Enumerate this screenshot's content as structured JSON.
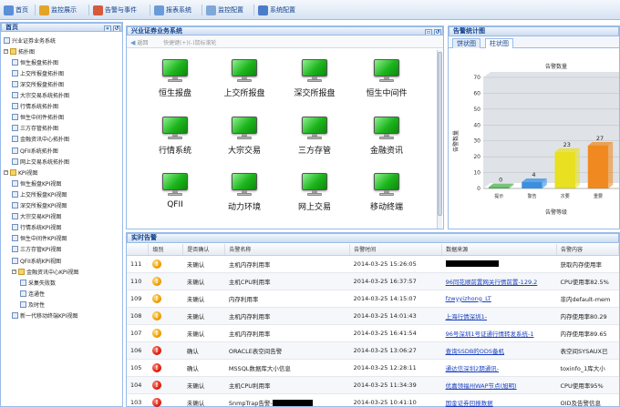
{
  "toolbar": {
    "items": [
      {
        "label": "首页",
        "icon": "home-icon"
      },
      {
        "label": "监控展示",
        "icon": "monitor-icon"
      },
      {
        "label": "告警与事件",
        "icon": "alarm-icon"
      },
      {
        "label": "报表系统",
        "icon": "report-icon"
      },
      {
        "label": "监控配置",
        "icon": "config-icon"
      },
      {
        "label": "系统配置",
        "icon": "system-icon"
      }
    ]
  },
  "sidebar": {
    "title": "首页",
    "header_buttons": [
      "«",
      "↺"
    ],
    "tree": [
      {
        "label": "兴业证券业务系统",
        "type": "leaf",
        "level": 0
      },
      {
        "label": "拓扑图",
        "type": "folder",
        "level": 0,
        "expanded": true
      },
      {
        "label": "恒生报盘拓扑图",
        "type": "leaf",
        "level": 1
      },
      {
        "label": "上交所报盘拓扑图",
        "type": "leaf",
        "level": 1
      },
      {
        "label": "深交所报盘拓扑图",
        "type": "leaf",
        "level": 1
      },
      {
        "label": "大宗交易系统拓扑图",
        "type": "leaf",
        "level": 1
      },
      {
        "label": "行情系统拓扑图",
        "type": "leaf",
        "level": 1
      },
      {
        "label": "恒生中间件拓扑图",
        "type": "leaf",
        "level": 1
      },
      {
        "label": "三方存管拓扑图",
        "type": "leaf",
        "level": 1
      },
      {
        "label": "金融资讯中心拓扑图",
        "type": "leaf",
        "level": 1
      },
      {
        "label": "QFII系统拓扑图",
        "type": "leaf",
        "level": 1
      },
      {
        "label": "网上交易系统拓扑图",
        "type": "leaf",
        "level": 1
      },
      {
        "label": "KPI视图",
        "type": "folder",
        "level": 0,
        "expanded": true
      },
      {
        "label": "恒生报盘KPI视图",
        "type": "leaf",
        "level": 1
      },
      {
        "label": "上交所报盘KPI视图",
        "type": "leaf",
        "level": 1
      },
      {
        "label": "深交所报盘KPI视图",
        "type": "leaf",
        "level": 1
      },
      {
        "label": "大宗交易KPI视图",
        "type": "leaf",
        "level": 1
      },
      {
        "label": "行情系统KPI视图",
        "type": "leaf",
        "level": 1
      },
      {
        "label": "恒生中间件KPI视图",
        "type": "leaf",
        "level": 1
      },
      {
        "label": "三方存管KPI视图",
        "type": "leaf",
        "level": 1
      },
      {
        "label": "QFII系统KPI视图",
        "type": "leaf",
        "level": 1
      },
      {
        "label": "金融资讯中心KPI视图",
        "type": "folder",
        "level": 1,
        "expanded": true
      },
      {
        "label": "采集失败数",
        "type": "leaf",
        "level": 2
      },
      {
        "label": "连通性",
        "type": "leaf",
        "level": 2
      },
      {
        "label": "及时性",
        "type": "leaf",
        "level": 2
      },
      {
        "label": "新一代移动终端KPI视图",
        "type": "leaf",
        "level": 1
      }
    ]
  },
  "business": {
    "title": "兴业证券业务系统",
    "back_label": "返回",
    "shortcut_hint": "快捷键(+)(-)鼠标滚轮",
    "systems": [
      "恒生报盘",
      "上交所报盘",
      "深交所报盘",
      "恒生中间件",
      "行情系统",
      "大宗交易",
      "三方存管",
      "金融资讯",
      "QFII",
      "动力环境",
      "网上交易",
      "移动终端"
    ]
  },
  "stats": {
    "title": "告警统计图",
    "tabs": [
      "饼状图",
      "柱状图"
    ],
    "active_tab": 1
  },
  "chart_data": {
    "type": "bar",
    "title": "告警数量",
    "xlabel": "告警等级",
    "ylabel": "告警数量",
    "categories": [
      "提示",
      "警告",
      "次要",
      "重要"
    ],
    "values": [
      0,
      4,
      23,
      27
    ],
    "colors": [
      "#4caf50",
      "#3a8fe0",
      "#e8e020",
      "#f08a20"
    ],
    "ylim": [
      0,
      70
    ],
    "yticks": [
      0,
      10,
      20,
      30,
      40,
      50,
      60,
      70
    ],
    "grid": true
  },
  "alarms": {
    "title": "实时告警",
    "columns": [
      "",
      "级别",
      "是否确认",
      "告警名称",
      "告警时间",
      "数据来源",
      "告警内容"
    ],
    "rows": [
      {
        "id": "111",
        "level": "orange",
        "ack": "未确认",
        "name": "主机内存利用率",
        "time": "2014-03-25 15:26:05",
        "source": "",
        "source_link": false,
        "content": "获取内存使用率",
        "redact_name": false
      },
      {
        "id": "110",
        "level": "orange",
        "ack": "未确认",
        "name": "主机CPU利用率",
        "time": "2014-03-25 16:37:57",
        "source": "96同花顺前置网关行情前置-129.2",
        "source_link": true,
        "content": "CPU使用率82.5%",
        "redact_name": false
      },
      {
        "id": "109",
        "level": "orange",
        "ack": "未确认",
        "name": "内存利用率",
        "time": "2014-03-25 14:15:07",
        "source": "fzwyyizhong_LT",
        "source_link": true,
        "content": "非内default-mem",
        "redact_name": false
      },
      {
        "id": "108",
        "level": "orange",
        "ack": "未确认",
        "name": "主机内存利用率",
        "time": "2014-03-25 14:01:43",
        "source": "上海行情深圳1-",
        "source_link": true,
        "content": "内存使用率80.29",
        "redact_name": false
      },
      {
        "id": "107",
        "level": "orange",
        "ack": "未确认",
        "name": "主机内存利用率",
        "time": "2014-03-25 16:41:54",
        "source": "96号深圳1号证通行情转发系统-1",
        "source_link": true,
        "content": "内存使用率89.65",
        "redact_name": false
      },
      {
        "id": "106",
        "level": "red",
        "ack": "确认",
        "name": "ORACLE表空间告警",
        "time": "2014-03-25 13:06:27",
        "source": "查询SSDB的ODS备机",
        "source_link": true,
        "content": "表空间SYSAUX已",
        "redact_name": false
      },
      {
        "id": "105",
        "level": "red",
        "ack": "确认",
        "name": "MSSQL数据库大小信息",
        "time": "2014-03-25 12:28:11",
        "source": "通达信深圳2期通讯-",
        "source_link": true,
        "content": "toxinfo_1库大小",
        "redact_name": false
      },
      {
        "id": "104",
        "level": "red",
        "ack": "未确认",
        "name": "主机CPU利用率",
        "time": "2014-03-25 11:34:39",
        "source": "优嘉领福州WAP节点(旭明)",
        "source_link": true,
        "content": "CPU使用率95%",
        "redact_name": false
      },
      {
        "id": "103",
        "level": "red",
        "ack": "未确认",
        "name": "SnmpTrap告警-",
        "time": "2014-03-25 10:41:10",
        "source": "国金证券回报数据",
        "source_link": true,
        "content": "OID及告警信息",
        "redact_name": true
      }
    ]
  }
}
